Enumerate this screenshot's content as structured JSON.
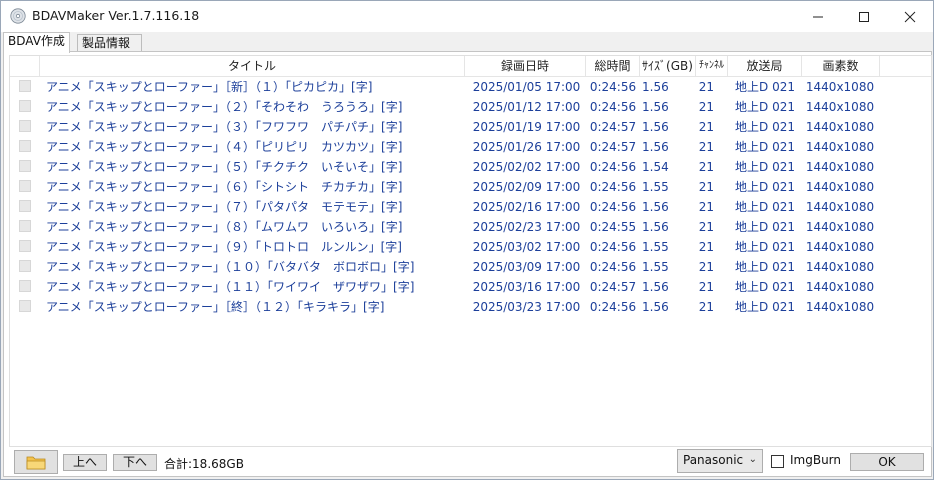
{
  "window": {
    "title": "BDAVMaker Ver.1.7.116.18"
  },
  "tabs": [
    {
      "label": "BDAV作成"
    },
    {
      "label": "製品情報"
    }
  ],
  "columns": {
    "title": "タイトル",
    "date": "録画日時",
    "duration": "総時間",
    "size": "ｻｲｽﾞ(GB)",
    "channel": "ﾁｬﾝﾈﾙ",
    "station": "放送局",
    "resolution": "画素数"
  },
  "rows": [
    {
      "title": "アニメ「スキップとローファー」［新］（１）「ピカピカ」[字]",
      "date": "2025/01/05 17:00",
      "duration": "0:24:56",
      "size": "1.56",
      "channel": "21",
      "station": "地上D 021",
      "resolution": "1440x1080"
    },
    {
      "title": "アニメ「スキップとローファー」（２）「そわそわ　うろうろ」[字]",
      "date": "2025/01/12 17:00",
      "duration": "0:24:56",
      "size": "1.56",
      "channel": "21",
      "station": "地上D 021",
      "resolution": "1440x1080"
    },
    {
      "title": "アニメ「スキップとローファー」（３）「フワフワ　パチパチ」[字]",
      "date": "2025/01/19 17:00",
      "duration": "0:24:57",
      "size": "1.56",
      "channel": "21",
      "station": "地上D 021",
      "resolution": "1440x1080"
    },
    {
      "title": "アニメ「スキップとローファー」（４）「ピリピリ　カツカツ」[字]",
      "date": "2025/01/26 17:00",
      "duration": "0:24:57",
      "size": "1.56",
      "channel": "21",
      "station": "地上D 021",
      "resolution": "1440x1080"
    },
    {
      "title": "アニメ「スキップとローファー」（５）「チクチク　いそいそ」[字]",
      "date": "2025/02/02 17:00",
      "duration": "0:24:56",
      "size": "1.54",
      "channel": "21",
      "station": "地上D 021",
      "resolution": "1440x1080"
    },
    {
      "title": "アニメ「スキップとローファー」（６）「シトシト　チカチカ」[字]",
      "date": "2025/02/09 17:00",
      "duration": "0:24:56",
      "size": "1.55",
      "channel": "21",
      "station": "地上D 021",
      "resolution": "1440x1080"
    },
    {
      "title": "アニメ「スキップとローファー」（７）「パタパタ　モテモテ」[字]",
      "date": "2025/02/16 17:00",
      "duration": "0:24:56",
      "size": "1.56",
      "channel": "21",
      "station": "地上D 021",
      "resolution": "1440x1080"
    },
    {
      "title": "アニメ「スキップとローファー」（８）「ムワムワ　いろいろ」[字]",
      "date": "2025/02/23 17:00",
      "duration": "0:24:55",
      "size": "1.56",
      "channel": "21",
      "station": "地上D 021",
      "resolution": "1440x1080"
    },
    {
      "title": "アニメ「スキップとローファー」（９）「トロトロ　ルンルン」[字]",
      "date": "2025/03/02 17:00",
      "duration": "0:24:56",
      "size": "1.55",
      "channel": "21",
      "station": "地上D 021",
      "resolution": "1440x1080"
    },
    {
      "title": "アニメ「スキップとローファー」（１０）「バタバタ　ボロボロ」[字]",
      "date": "2025/03/09 17:00",
      "duration": "0:24:56",
      "size": "1.55",
      "channel": "21",
      "station": "地上D 021",
      "resolution": "1440x1080"
    },
    {
      "title": "アニメ「スキップとローファー」（１１）「ワイワイ　ザワザワ」[字]",
      "date": "2025/03/16 17:00",
      "duration": "0:24:57",
      "size": "1.56",
      "channel": "21",
      "station": "地上D 021",
      "resolution": "1440x1080"
    },
    {
      "title": "アニメ「スキップとローファー」［終］（１２）「キラキラ」[字]",
      "date": "2025/03/23 17:00",
      "duration": "0:24:56",
      "size": "1.56",
      "channel": "21",
      "station": "地上D 021",
      "resolution": "1440x1080"
    }
  ],
  "footer": {
    "up_label": "上へ",
    "down_label": "下へ",
    "total_label": "合計:18.68GB",
    "maker_select_value": "Panasonic",
    "imgburn_label": "ImgBurn",
    "ok_label": "OK"
  },
  "colors": {
    "row_text": "#1c3f9a",
    "header_text": "#222222",
    "window_bg": "#f0f0f0"
  },
  "icons": {
    "app": "disc-icon",
    "folder": "folder-icon"
  }
}
